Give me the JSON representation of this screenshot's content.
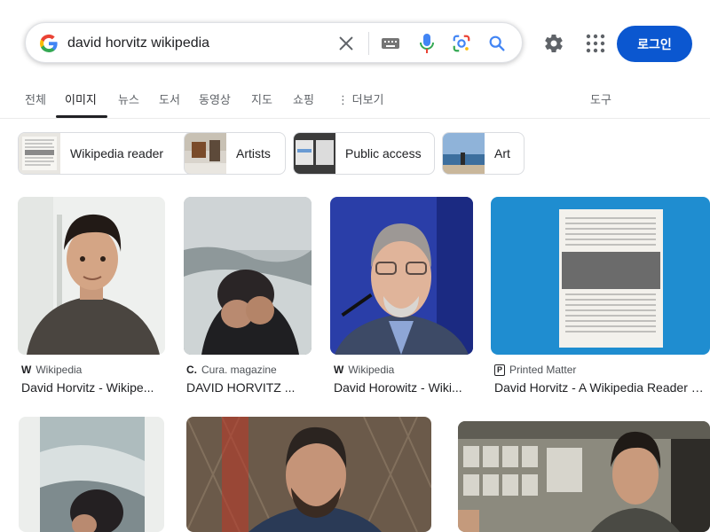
{
  "search": {
    "query": "david horvitz wikipedia",
    "icons": [
      "google-g-icon",
      "close-icon",
      "keyboard-icon",
      "mic-icon",
      "lens-icon",
      "search-icon"
    ]
  },
  "header": {
    "login_label": "로그인",
    "icons": [
      "gear-icon",
      "apps-grid-icon"
    ]
  },
  "tabs": [
    {
      "label": "전체",
      "active": false
    },
    {
      "label": "이미지",
      "active": true
    },
    {
      "label": "뉴스",
      "active": false
    },
    {
      "label": "도서",
      "active": false
    },
    {
      "label": "동영상",
      "active": false
    },
    {
      "label": "지도",
      "active": false
    },
    {
      "label": "쇼핑",
      "active": false
    },
    {
      "label": "⋮ 더보기",
      "active": false
    }
  ],
  "tools_label": "도구",
  "chips": [
    {
      "label": "Wikipedia reader"
    },
    {
      "label": "Artists"
    },
    {
      "label": "Public access"
    },
    {
      "label": "Art"
    }
  ],
  "results": [
    {
      "source_icon": "W",
      "source": "Wikipedia",
      "title": "David Horvitz - Wikipe..."
    },
    {
      "source_icon": "C.",
      "source": "Cura. magazine",
      "title": "DAVID HORVITZ ..."
    },
    {
      "source_icon": "W",
      "source": "Wikipedia",
      "title": "David Horowitz - Wiki..."
    },
    {
      "source_icon": "P",
      "source": "Printed Matter",
      "title": "David Horvitz - A Wikipedia Reader - ..."
    }
  ],
  "colors": {
    "accent": "#0b57d0",
    "text": "#202124",
    "muted": "#5f6368"
  }
}
